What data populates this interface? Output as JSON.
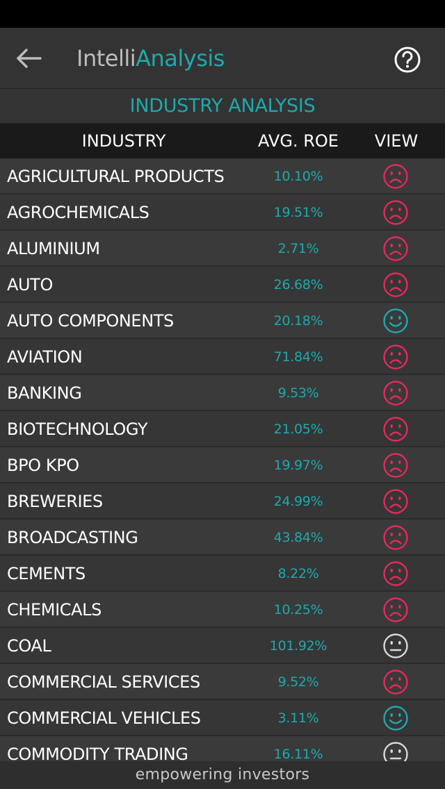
{
  "app": {
    "title_part1": "Intelli",
    "title_part2": "Analysis",
    "accent": "#1fa9ad"
  },
  "section_title": "INDUSTRY ANALYSIS",
  "table": {
    "headers": {
      "industry": "INDUSTRY",
      "roe": "AVG. ROE",
      "view": "VIEW"
    },
    "rows": [
      {
        "industry": "AGRICULTURAL PRODUCTS",
        "roe": "10.10%",
        "view": "sad"
      },
      {
        "industry": "AGROCHEMICALS",
        "roe": "19.51%",
        "view": "sad"
      },
      {
        "industry": "ALUMINIUM",
        "roe": "2.71%",
        "view": "sad"
      },
      {
        "industry": "AUTO",
        "roe": "26.68%",
        "view": "sad"
      },
      {
        "industry": "AUTO COMPONENTS",
        "roe": "20.18%",
        "view": "happy"
      },
      {
        "industry": "AVIATION",
        "roe": "71.84%",
        "view": "sad"
      },
      {
        "industry": "BANKING",
        "roe": "9.53%",
        "view": "sad"
      },
      {
        "industry": "BIOTECHNOLOGY",
        "roe": "21.05%",
        "view": "sad"
      },
      {
        "industry": "BPO KPO",
        "roe": "19.97%",
        "view": "sad"
      },
      {
        "industry": "BREWERIES",
        "roe": "24.99%",
        "view": "sad"
      },
      {
        "industry": "BROADCASTING",
        "roe": "43.84%",
        "view": "sad"
      },
      {
        "industry": "CEMENTS",
        "roe": "8.22%",
        "view": "sad"
      },
      {
        "industry": "CHEMICALS",
        "roe": "10.25%",
        "view": "sad"
      },
      {
        "industry": "COAL",
        "roe": "101.92%",
        "view": "neutral"
      },
      {
        "industry": "COMMERCIAL SERVICES",
        "roe": "9.52%",
        "view": "sad"
      },
      {
        "industry": "COMMERCIAL VEHICLES",
        "roe": "3.11%",
        "view": "happy"
      },
      {
        "industry": "COMMODITY TRADING",
        "roe": "16.11%",
        "view": "neutral"
      }
    ]
  },
  "face_colors": {
    "sad": "#e8285a",
    "happy": "#1fa9ad",
    "neutral": "#d9d9d9"
  },
  "icons": {
    "back": "arrow-left-icon",
    "help": "question-circle-icon"
  },
  "footer": "empowering investors"
}
